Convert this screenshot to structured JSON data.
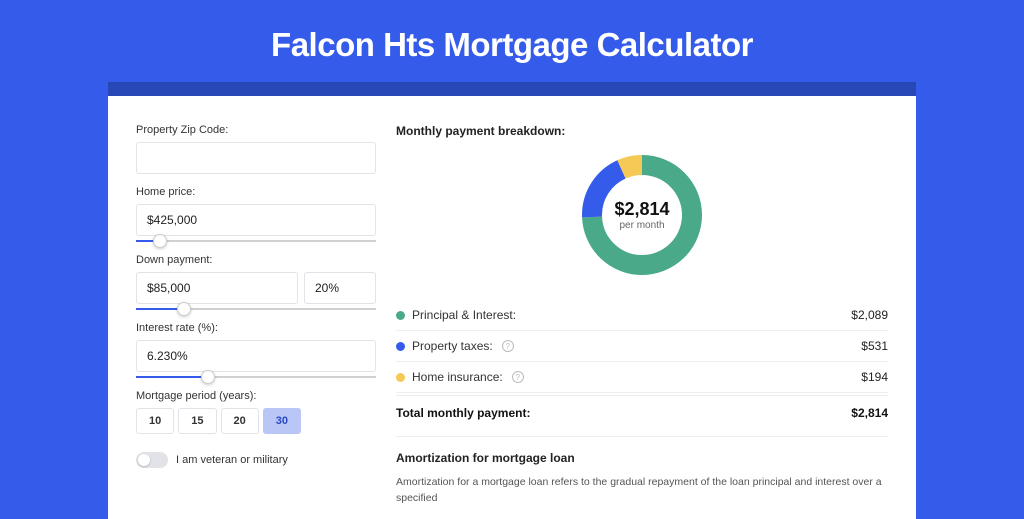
{
  "page_title": "Falcon Hts Mortgage Calculator",
  "form": {
    "zip_label": "Property Zip Code:",
    "zip_value": "",
    "home_price_label": "Home price:",
    "home_price_value": "$425,000",
    "home_price_slider_pct": 10,
    "down_payment_label": "Down payment:",
    "down_payment_value": "$85,000",
    "down_payment_pct_value": "20%",
    "down_payment_slider_pct": 20,
    "interest_label": "Interest rate (%):",
    "interest_value": "6.230%",
    "interest_slider_pct": 30,
    "period_label": "Mortgage period (years):",
    "period_options": [
      "10",
      "15",
      "20",
      "30"
    ],
    "period_selected": "30",
    "veteran_label": "I am veteran or military"
  },
  "breakdown": {
    "title": "Monthly payment breakdown:",
    "center_value": "$2,814",
    "center_sub": "per month",
    "items": [
      {
        "label": "Principal & Interest:",
        "value": "$2,089",
        "color": "green",
        "info": false
      },
      {
        "label": "Property taxes:",
        "value": "$531",
        "color": "blue",
        "info": true
      },
      {
        "label": "Home insurance:",
        "value": "$194",
        "color": "yellow",
        "info": true
      }
    ],
    "total_label": "Total monthly payment:",
    "total_value": "$2,814"
  },
  "amort": {
    "title": "Amortization for mortgage loan",
    "text": "Amortization for a mortgage loan refers to the gradual repayment of the loan principal and interest over a specified"
  },
  "chart_data": {
    "type": "pie",
    "title": "Monthly payment breakdown",
    "categories": [
      "Principal & Interest",
      "Property taxes",
      "Home insurance"
    ],
    "values": [
      2089,
      531,
      194
    ],
    "colors": [
      "#4aa989",
      "#345bea",
      "#f4c955"
    ],
    "total": 2814,
    "center_label": "$2,814 per month"
  }
}
